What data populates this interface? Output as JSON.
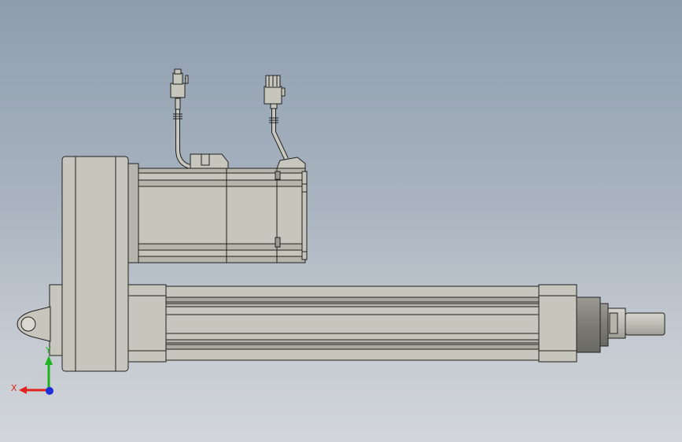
{
  "view": {
    "background_top": "#8e9dae",
    "background_bottom": "#d2d6da",
    "part_fill": "#c6c6bd",
    "part_shade": "#a9a9a0",
    "edge_color": "#202020"
  },
  "triad": {
    "x_label": "X",
    "y_label": "Y",
    "x_color": "#e0241c",
    "y_color": "#1fb31f",
    "z_color": "#1d2fd6"
  }
}
